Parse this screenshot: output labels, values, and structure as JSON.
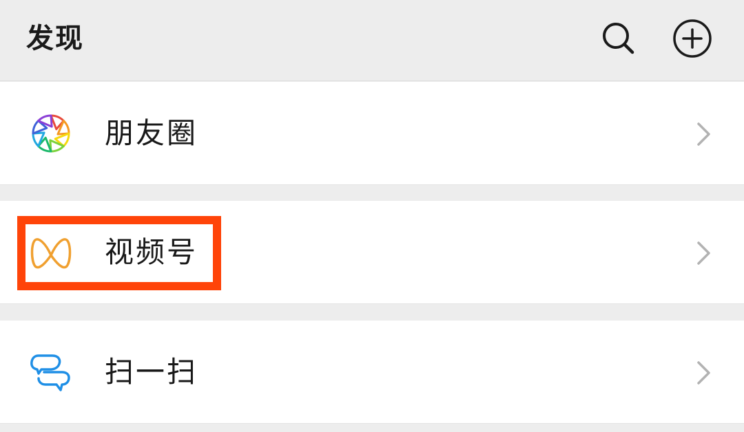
{
  "header": {
    "title": "发现",
    "search_icon": "search-icon",
    "add_icon": "plus-circle-icon"
  },
  "items": [
    {
      "label": "朋友圈",
      "icon": "moments-aperture-icon",
      "chevron": "chevron-right-icon"
    },
    {
      "label": "视频号",
      "icon": "channels-icon",
      "chevron": "chevron-right-icon",
      "highlighted": true
    },
    {
      "label": "扫一扫",
      "icon": "scan-icon",
      "chevron": "chevron-right-icon"
    }
  ],
  "colors": {
    "background": "#ededed",
    "row_background": "#ffffff",
    "highlight": "#ff4409",
    "chevron": "#b2b2b2",
    "channels_icon": "#f0a030",
    "scan_icon": "#1f8fe6"
  }
}
